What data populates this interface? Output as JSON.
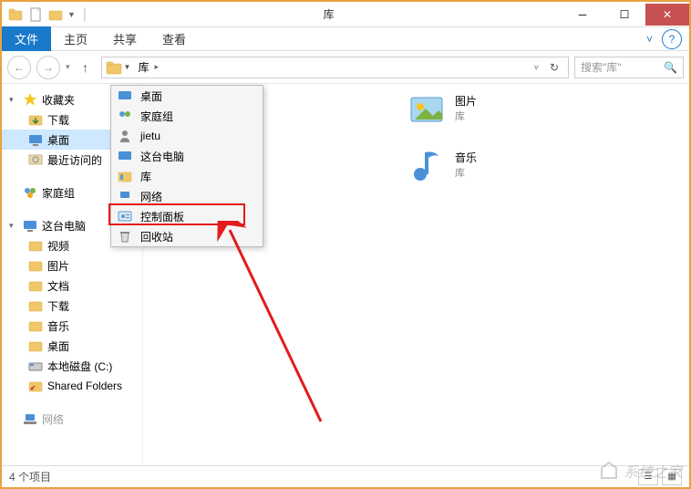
{
  "window_title": "库",
  "ribbon": {
    "file": "文件",
    "home": "主页",
    "share": "共享",
    "view": "查看"
  },
  "address": {
    "crumb_library": "库",
    "search_placeholder": "搜索\"库\""
  },
  "sidebar": {
    "favorites": "收藏夹",
    "downloads": "下载",
    "desktop": "桌面",
    "recent": "最近访问的",
    "homegroup": "家庭组",
    "this_pc": "这台电脑",
    "videos": "视频",
    "pictures": "图片",
    "documents": "文档",
    "downloads2": "下载",
    "music": "音乐",
    "desktop2": "桌面",
    "local_disk": "本地磁盘 (C:)",
    "shared": "Shared Folders",
    "network": "网络"
  },
  "dropdown": {
    "desktop": "桌面",
    "homegroup": "家庭组",
    "jietu": "jietu",
    "this_pc": "这台电脑",
    "library": "库",
    "network": "网络",
    "control_panel": "控制面板",
    "recycle_bin": "回收站"
  },
  "content": {
    "pictures": "图片",
    "pictures_sub": "库",
    "music": "音乐",
    "music_sub": "库"
  },
  "statusbar": {
    "count": "4 个项目"
  },
  "watermark": "系统之家"
}
